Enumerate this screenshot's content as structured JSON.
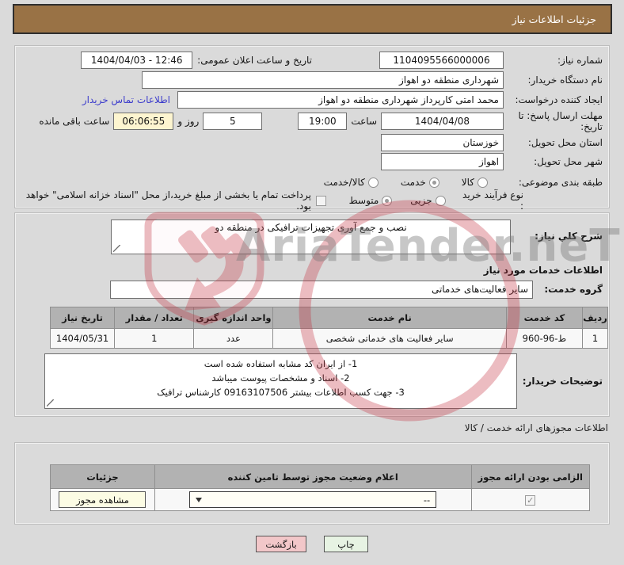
{
  "header": {
    "title": "جزئیات اطلاعات نیاز"
  },
  "watermark": {
    "text": "AriaTender.neT",
    "red": "#c4303e",
    "gray": "#7a7a7a"
  },
  "colors": {
    "brand_brown": "#997245",
    "link_blue": "#3c3ccc",
    "highlight_yellow": "#fdf5d0",
    "back_pink": "#f2c7c9",
    "print_green": "#e7f3e3",
    "table_header_gray": "#b2b2b2"
  },
  "info": {
    "need_number_label": "شماره نیاز:",
    "need_number_value": "1104095566000006",
    "announce_label": "تاریخ و ساعت اعلان عمومی:",
    "announce_value": "1404/04/03 - 12:46",
    "buyer_org_label": "نام دستگاه خریدار:",
    "buyer_org_value": "شهرداری منطقه دو اهواز",
    "creator_label": "ایجاد کننده درخواست:",
    "creator_value": "محمد امتی کارپرداز شهرداری منطقه دو اهواز",
    "contact_link": "اطلاعات تماس خریدار",
    "deadline_label_line1": "مهلت ارسال پاسخ: تا",
    "deadline_label_line2": "تاریخ:",
    "deadline_date": "1404/04/08",
    "hour_label": "ساعت",
    "deadline_time": "19:00",
    "days_value": "5",
    "days_label": "روز و",
    "remaining_time": "06:06:55",
    "remaining_label": "ساعت باقی مانده",
    "province_label": "استان محل تحویل:",
    "province_value": "خوزستان",
    "city_label": "شهر محل تحویل:",
    "city_value": "اهواز",
    "classification_label": "طبقه بندی موضوعی:",
    "class_options": [
      {
        "label": "کالا",
        "selected": false
      },
      {
        "label": "خدمت",
        "selected": true
      },
      {
        "label": "کالا/خدمت",
        "selected": false
      }
    ],
    "process_label": "نوع فرآیند خرید :",
    "process_options": [
      {
        "label": "جزیی",
        "selected": false
      },
      {
        "label": "متوسط",
        "selected": true
      }
    ],
    "treasury_checkbox_checked": false,
    "treasury_checkbox_label": "پرداخت تمام یا بخشی از مبلغ خرید،از محل \"اسناد خزانه اسلامی\" خواهد بود."
  },
  "need_desc": {
    "label": "شرح كلي نياز:",
    "value": "نصب و جمع آوری تجهیزات ترافیکی در منطقه دو",
    "section_title": "اطلاعات خدمات مورد نياز",
    "group_label": "گروه خدمت:",
    "group_value": "سایر فعالیت‌های خدماتی"
  },
  "services_table": {
    "headers": [
      "ردیف",
      "کد خدمت",
      "نام خدمت",
      "واحد اندازه گیری",
      "تعداد / مقدار",
      "تاریخ نیاز"
    ],
    "rows": [
      [
        "1",
        "960-96-ط",
        "سایر فعالیت های خدماتی شخصی",
        "عدد",
        "1",
        "1404/05/31"
      ]
    ]
  },
  "buyer_notes": {
    "label": "توضیحات خریدار:",
    "lines": [
      "1- از ایران کد مشابه استفاده شده است",
      "2- اسناد و مشخصات پیوست میباشد",
      "3- جهت کسب اطلاعات بیشتر 09163107506 کارشناس ترافیک"
    ]
  },
  "license_section": {
    "title": "اطلاعات مجوزهای ارائه خدمت / کالا",
    "headers": [
      "الزامی بودن ارائه مجوز",
      "اعلام وضعیت مجوز توسط تامین کننده",
      "جزئیات"
    ],
    "license_required_checked": true,
    "select_value": "--",
    "view_button": "مشاهده مجوز"
  },
  "footer": {
    "print_button": "چاپ",
    "back_button": "بازگشت"
  }
}
